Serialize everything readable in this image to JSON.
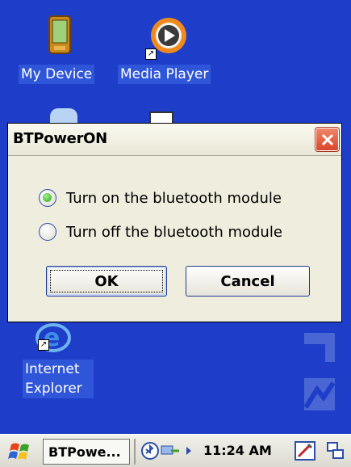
{
  "desktop": {
    "icons": [
      {
        "label": "My Device"
      },
      {
        "label": "Media Player"
      },
      {
        "label": "Internet Explorer"
      }
    ]
  },
  "dialog": {
    "title": "BTPowerON",
    "options": [
      {
        "label": "Turn on the bluetooth module",
        "checked": true
      },
      {
        "label": "Turn off the bluetooth module",
        "checked": false
      }
    ],
    "ok_label": "OK",
    "cancel_label": "Cancel"
  },
  "taskbar": {
    "task_label": "BTPowe...",
    "clock": "11:24 AM"
  },
  "colors": {
    "desktop": "#1e3dc8",
    "dialog_bg": "#efedde",
    "close_button": "#d9462a",
    "radio_selected": "#2fa31a"
  }
}
